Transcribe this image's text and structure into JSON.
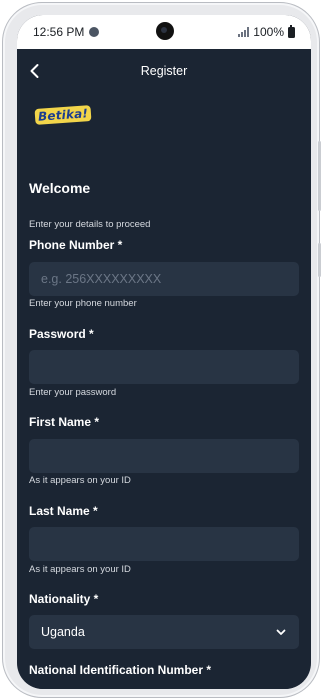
{
  "status_bar": {
    "time": "12:56 PM",
    "battery_text": "100%"
  },
  "app_bar": {
    "title": "Register",
    "back_icon": "chevron-left-icon"
  },
  "brand": {
    "logo_text": "Betika!",
    "colors": {
      "logo_bg": "#f2d54a",
      "logo_text": "#1c3d8f"
    }
  },
  "form": {
    "heading": "Welcome",
    "subheading": "Enter your details to proceed",
    "phone": {
      "label": "Phone Number *",
      "placeholder": "e.g. 256XXXXXXXXX",
      "value": "",
      "hint": "Enter your phone number"
    },
    "password": {
      "label": "Password *",
      "value": "",
      "hint": "Enter your password"
    },
    "first_name": {
      "label": "First Name *",
      "value": "",
      "hint": "As it appears on your ID"
    },
    "last_name": {
      "label": "Last Name *",
      "value": "",
      "hint": "As it appears on your ID"
    },
    "nationality": {
      "label": "Nationality *",
      "selected": "Uganda"
    },
    "national_id": {
      "label": "National Identification Number *"
    }
  },
  "theme": {
    "background": "#1b2533",
    "field_bg": "#283444",
    "text": "#ffffff",
    "hint": "#d5d9df"
  }
}
